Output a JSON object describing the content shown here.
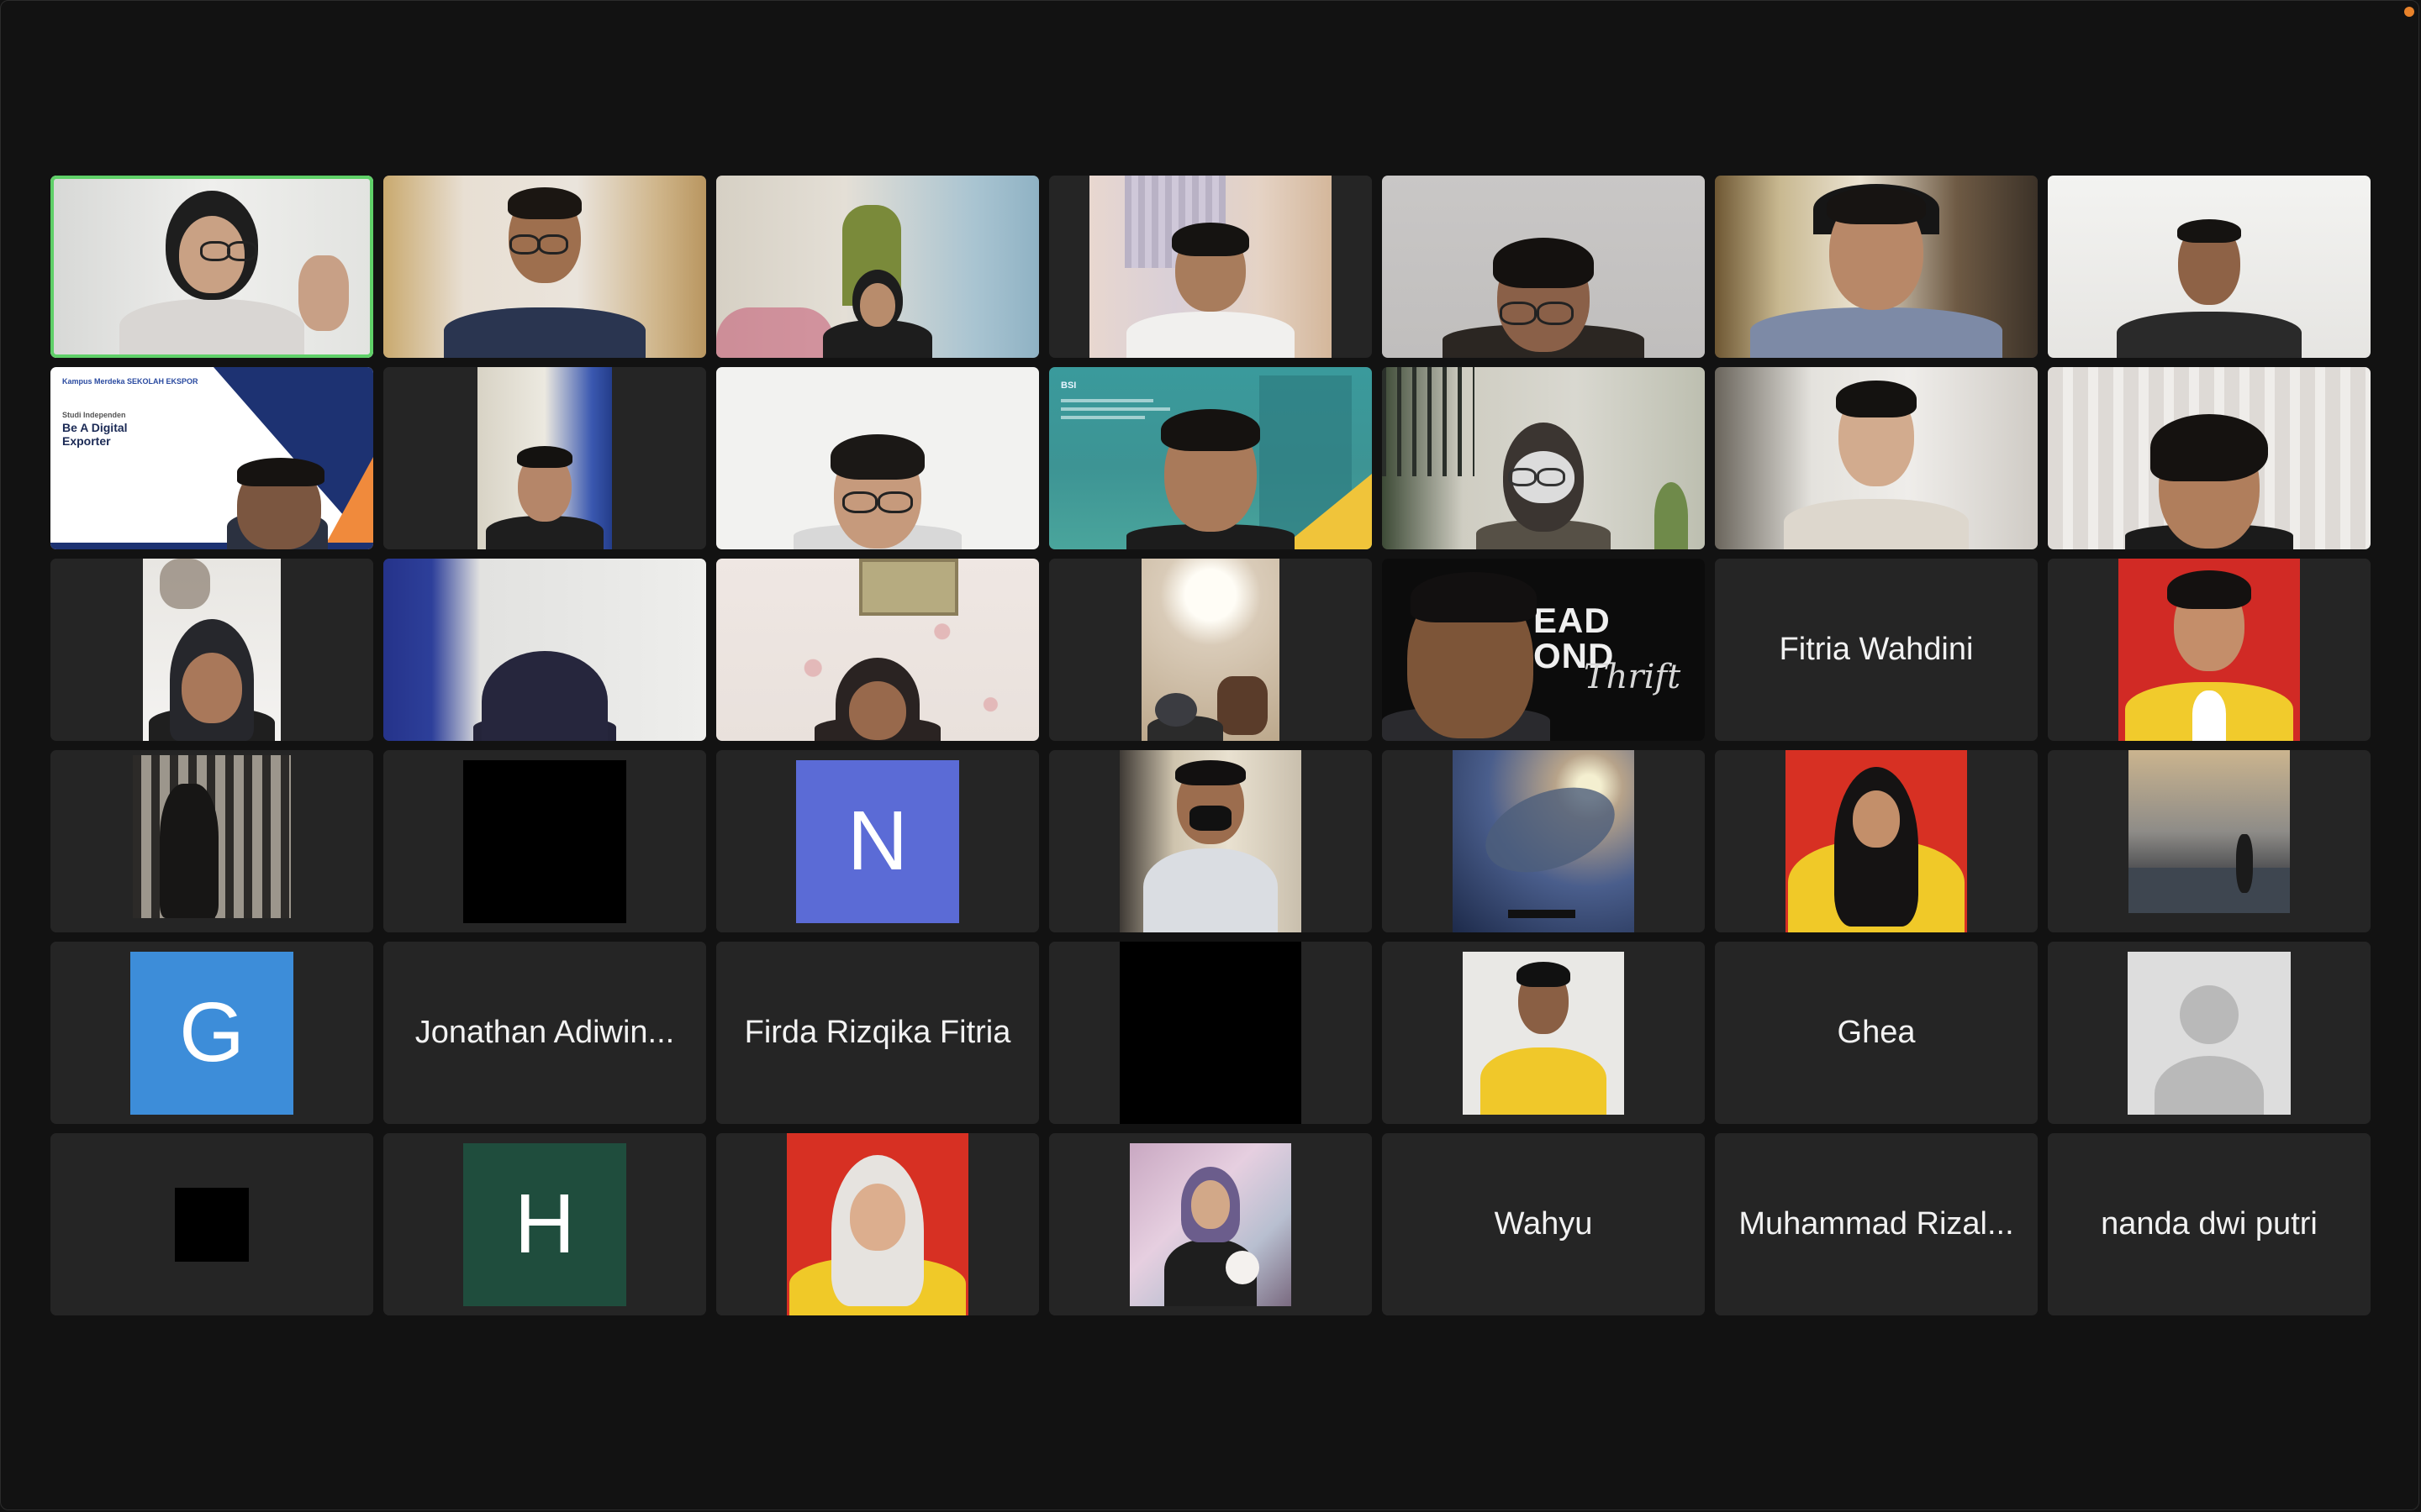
{
  "participants": {
    "jonathan": "Jonathan Adiwin...",
    "firda": "Firda Rizqika Fitria",
    "fitria": "Fitria Wahdini",
    "ghea": "Ghea",
    "wahyu": "Wahyu",
    "rizal": "Muhammad Rizal...",
    "nanda": "nanda dwi putri"
  },
  "initials": {
    "n": "N",
    "g": "G",
    "h": "H"
  },
  "slide": {
    "logos": "Kampus Merdeka  SEKOLAH EKSPOR",
    "subtitle": "Studi Independen",
    "title_line1": "Be A Digital",
    "title_line2": "Exporter"
  },
  "teal_slide": {
    "logo": "BSI"
  },
  "thrift_banner": {
    "line1": "EAD",
    "line2": "OND",
    "script": "Thrift"
  },
  "colors": {
    "speaking_border": "#5fd068",
    "tile_bg": "#252525",
    "page_bg": "#121212",
    "initial_n": "#5b6bd6",
    "initial_g": "#3d8dd9",
    "initial_h": "#1f4d3d"
  }
}
